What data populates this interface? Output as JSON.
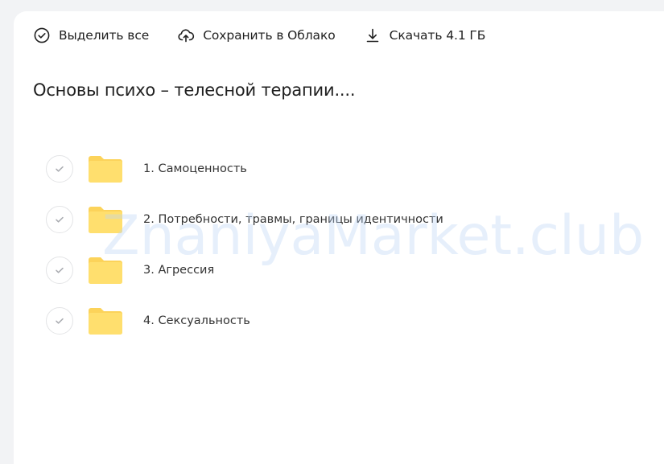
{
  "toolbar": {
    "select_all": {
      "label": "Выделить все",
      "icon": "check-circle-icon"
    },
    "save_to_cloud": {
      "label": "Сохранить в Облако",
      "icon": "cloud-upload-icon"
    },
    "download": {
      "label": "Скачать 4.1 ГБ",
      "icon": "download-icon"
    }
  },
  "folder_title": "Основы психо – телесной терапии....",
  "items": [
    {
      "label": "1. Самоценность",
      "icon": "folder-icon"
    },
    {
      "label": "2. Потребности, травмы, границы идентичности",
      "icon": "folder-icon"
    },
    {
      "label": "3. Агрессия",
      "icon": "folder-icon"
    },
    {
      "label": "4. Сексуальность",
      "icon": "folder-icon"
    }
  ],
  "watermark": "ZnaniyaMarket.club",
  "colors": {
    "folder": "#ffdf6e",
    "folder_tab": "#fcd35a",
    "page_bg": "#f2f3f5",
    "panel_bg": "#ffffff",
    "text": "#1f1f1f"
  }
}
